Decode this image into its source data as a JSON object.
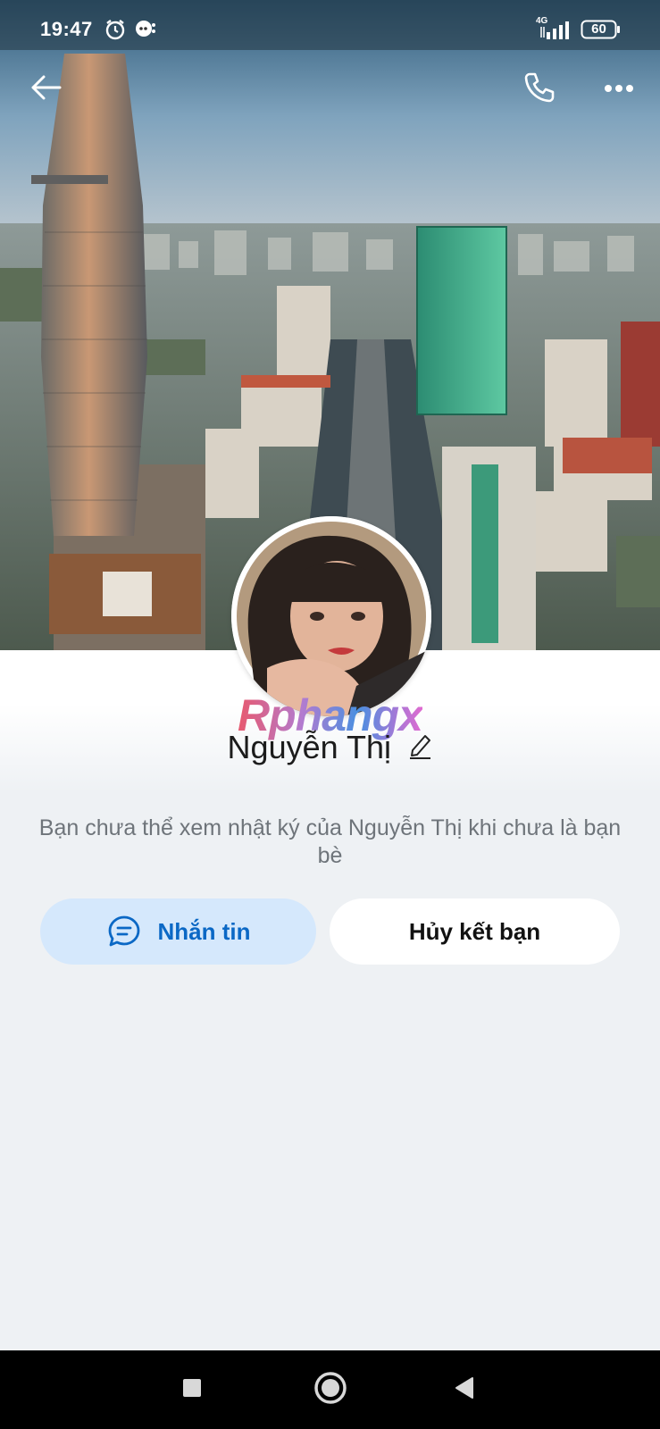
{
  "status_bar": {
    "time": "19:47",
    "network": "4G",
    "battery": "60"
  },
  "top_bar": {
    "back_icon": "arrow-left-icon",
    "call_icon": "phone-icon",
    "more_icon": "more-dots-icon"
  },
  "profile": {
    "watermark": "Rphangx",
    "name": "Nguyễn Thị",
    "edit_icon": "pencil-icon",
    "notice": "Bạn chưa thể xem nhật ký của Nguyễn Thị khi chưa là bạn bè"
  },
  "actions": {
    "message_label": "Nhắn tin",
    "message_icon": "chat-bubble-icon",
    "unfriend_label": "Hủy kết bạn"
  },
  "colors": {
    "accent": "#0b68c5",
    "message_button_bg": "#d5e8fc",
    "page_bg": "#eef1f4"
  },
  "nav_bar": {
    "recent_icon": "square-icon",
    "home_icon": "circle-icon",
    "back_icon": "triangle-back-icon"
  }
}
